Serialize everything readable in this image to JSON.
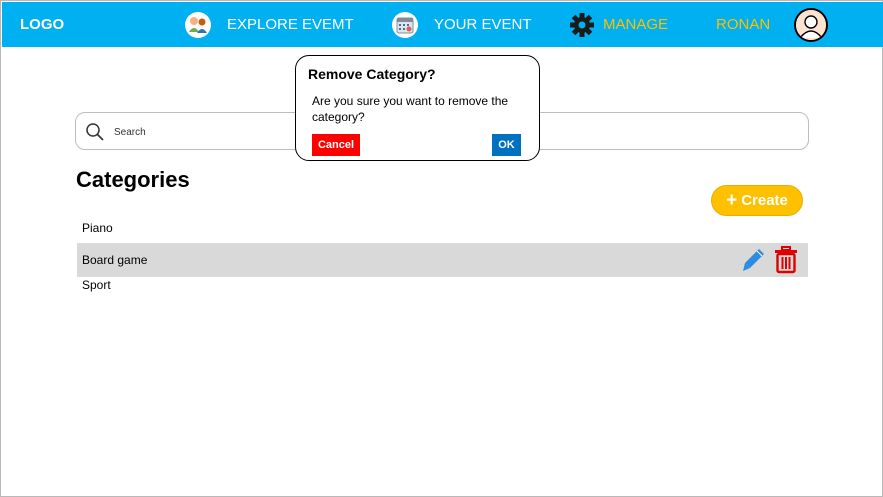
{
  "header": {
    "logo": "LOGO",
    "nav": [
      {
        "label": "EXPLORE EVEMT",
        "icon": "people-icon"
      },
      {
        "label": "YOUR EVENT",
        "icon": "calendar-icon"
      },
      {
        "label": "MANAGE",
        "icon": "gear-icon"
      },
      {
        "label": "RONAN",
        "icon": "avatar-icon"
      }
    ]
  },
  "search": {
    "placeholder": "Search",
    "value": ""
  },
  "categories": {
    "title": "Categories",
    "create_label": "Create",
    "items": [
      {
        "label": "Piano"
      },
      {
        "label": "Board game",
        "selected": true
      },
      {
        "label": "Sport"
      }
    ]
  },
  "dialog": {
    "title": "Remove Category?",
    "message": "Are you sure you want to remove the category?",
    "cancel_label": "Cancel",
    "ok_label": "OK"
  },
  "colors": {
    "header_bg": "#00b0f0",
    "accent_yellow": "#ffc000",
    "cancel_red": "#ff0000",
    "ok_blue": "#0070c0",
    "edit_blue": "#2e8ce0",
    "selected_row": "#d9d9d9"
  }
}
